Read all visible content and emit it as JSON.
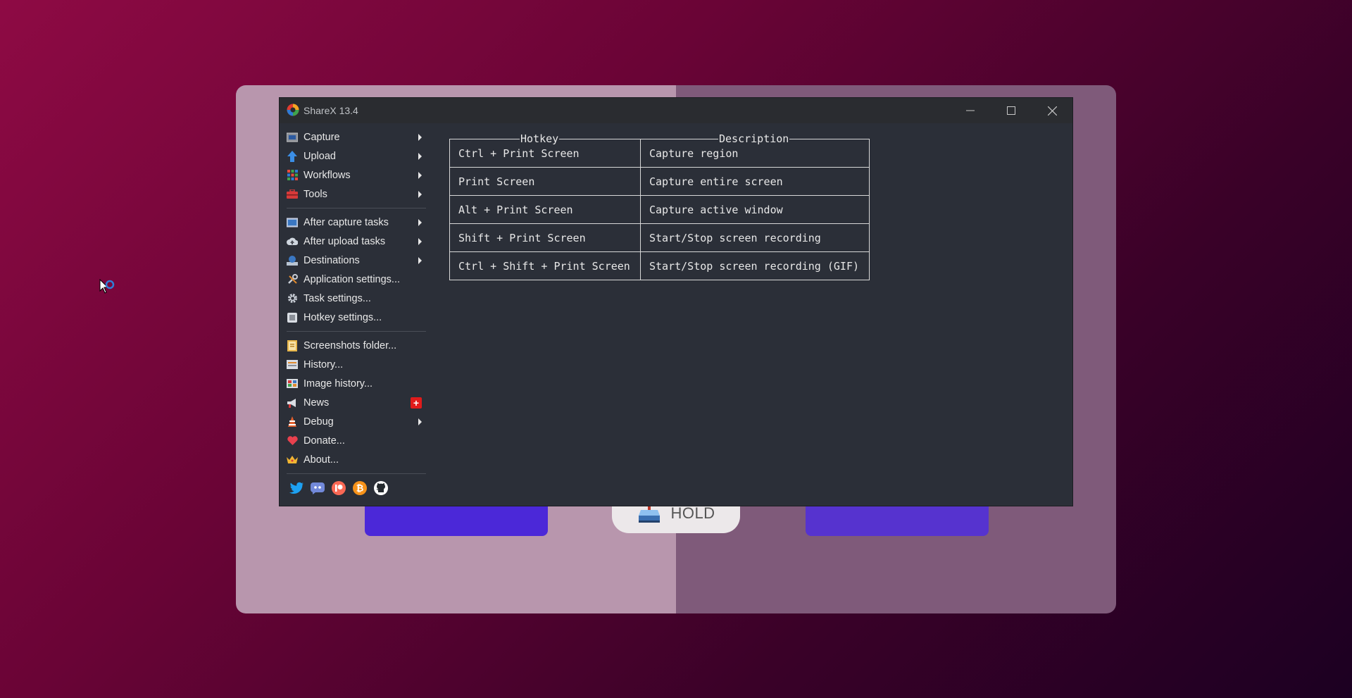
{
  "window": {
    "title": "ShareX 13.4"
  },
  "menu": {
    "group1": [
      {
        "label": "Capture",
        "icon": "capture-icon",
        "submenu": true
      },
      {
        "label": "Upload",
        "icon": "upload-icon",
        "submenu": true
      },
      {
        "label": "Workflows",
        "icon": "workflows-icon",
        "submenu": true
      },
      {
        "label": "Tools",
        "icon": "tools-icon",
        "submenu": true
      }
    ],
    "group2": [
      {
        "label": "After capture tasks",
        "icon": "after-capture-icon",
        "submenu": true
      },
      {
        "label": "After upload tasks",
        "icon": "after-upload-icon",
        "submenu": true
      },
      {
        "label": "Destinations",
        "icon": "destinations-icon",
        "submenu": true
      },
      {
        "label": "Application settings...",
        "icon": "wrench-icon",
        "submenu": false
      },
      {
        "label": "Task settings...",
        "icon": "gear-icon",
        "submenu": false
      },
      {
        "label": "Hotkey settings...",
        "icon": "keyboard-icon",
        "submenu": false
      }
    ],
    "group3": [
      {
        "label": "Screenshots folder...",
        "icon": "folder-icon",
        "submenu": false
      },
      {
        "label": "History...",
        "icon": "history-icon",
        "submenu": false
      },
      {
        "label": "Image history...",
        "icon": "image-history-icon",
        "submenu": false
      },
      {
        "label": "News",
        "icon": "megaphone-icon",
        "badge": "+"
      },
      {
        "label": "Debug",
        "icon": "debug-icon",
        "submenu": true
      },
      {
        "label": "Donate...",
        "icon": "heart-icon",
        "submenu": false
      },
      {
        "label": "About...",
        "icon": "crown-icon",
        "submenu": false
      }
    ],
    "social": [
      "twitter-icon",
      "discord-icon",
      "patreon-icon",
      "bitcoin-icon",
      "github-icon"
    ]
  },
  "hotkeys": {
    "headers": {
      "hotkey": "Hotkey",
      "description": "Description"
    },
    "rows": [
      {
        "key": "Ctrl + Print Screen",
        "desc": "Capture region"
      },
      {
        "key": "Print Screen",
        "desc": "Capture entire screen"
      },
      {
        "key": "Alt + Print Screen",
        "desc": "Capture active window"
      },
      {
        "key": "Shift + Print Screen",
        "desc": "Start/Stop screen recording"
      },
      {
        "key": "Ctrl + Shift + Print Screen",
        "desc": "Start/Stop screen recording (GIF)"
      }
    ]
  },
  "background": {
    "hold_label": "HOLD"
  },
  "colors": {
    "accent": "#4b28d8",
    "badge": "#e01b1b",
    "window_bg": "#2b2f38"
  }
}
